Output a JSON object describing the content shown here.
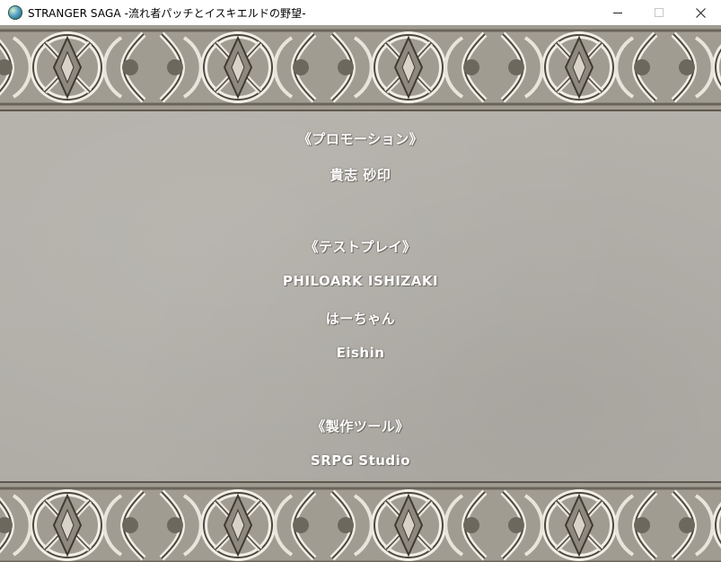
{
  "window": {
    "title": "STRANGER SAGA -流れ者パッチとイスキエルドの野望-",
    "icon": "globe-icon",
    "controls": [
      "minimize-icon",
      "maximize-icon",
      "close-icon"
    ]
  },
  "colors": {
    "background_stone": "#b3b0aa",
    "border_dark": "#5d584e",
    "text": "#ffffff"
  },
  "credits": [
    {
      "text": "《プロモーション》",
      "kind": "heading"
    },
    {
      "text": "貴志 砂印",
      "kind": "name"
    },
    {
      "text": "《テストプレイ》",
      "kind": "heading"
    },
    {
      "text": "PHILOARK ISHIZAKI",
      "kind": "name"
    },
    {
      "text": "はーちゃん",
      "kind": "name"
    },
    {
      "text": "Eishin",
      "kind": "name"
    },
    {
      "text": "《製作ツール》",
      "kind": "heading"
    },
    {
      "text": "SRPG Studio",
      "kind": "name"
    }
  ]
}
